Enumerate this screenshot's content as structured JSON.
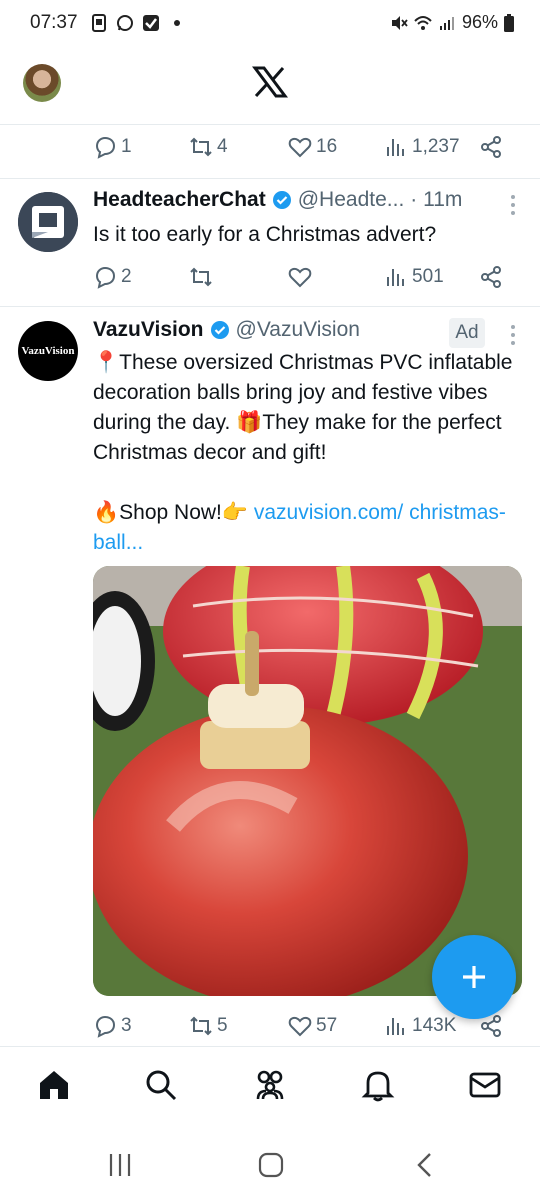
{
  "status_bar": {
    "time": "07:37",
    "battery": "96%",
    "icons_left": [
      "sim-icon",
      "whatsapp-icon",
      "check-icon",
      "dot-icon"
    ],
    "icons_right": [
      "mute-icon",
      "wifi-icon",
      "signal-icon",
      "battery-icon"
    ]
  },
  "top_bar": {
    "logo": "x-logo-icon",
    "avatar": "profile-avatar"
  },
  "prev_tweet_actions": {
    "replies": "1",
    "retweets": "4",
    "likes": "16",
    "views": "1,237"
  },
  "tweet1": {
    "name": "HeadteacherChat",
    "handle": "@Headte...",
    "time": "· 11m",
    "text": "Is it too early for a Christmas advert?",
    "replies": "2",
    "retweets": "",
    "likes": "",
    "views": "501"
  },
  "tweet2": {
    "name": "VazuVision",
    "handle": "@VazuVision",
    "ad_label": "Ad",
    "avatar_text": "VazuVision",
    "text_line1": "📍These oversized Christmas PVC inflatable decoration balls bring joy and festive vibes during the day. 🎁They make for the perfect Christmas decor and gift!",
    "shop_text": "🔥Shop Now!👉 ",
    "link_text": "vazuvision.com/ christmas-ball...",
    "replies": "3",
    "retweets": "5",
    "likes": "57",
    "views": "143K"
  },
  "colors": {
    "accent": "#1d9bf0",
    "muted": "#536471",
    "text": "#0f1419"
  },
  "nav": [
    "home-icon",
    "search-icon",
    "communities-icon",
    "notifications-icon",
    "messages-icon"
  ]
}
